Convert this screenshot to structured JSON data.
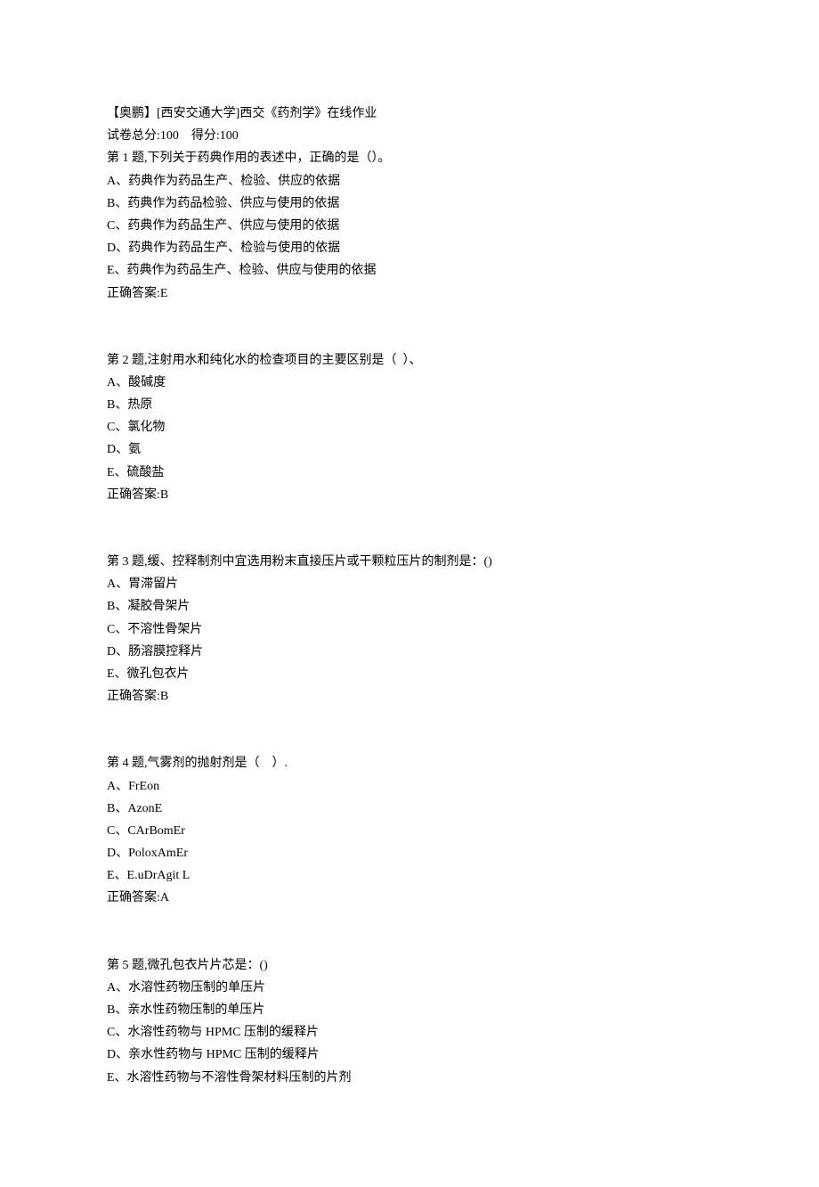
{
  "header": {
    "title": "【奥鹏】[西安交通大学]西交《药剂学》在线作业",
    "score_line": "试卷总分:100    得分:100"
  },
  "questions": [
    {
      "prompt": "第 1 题,下列关于药典作用的表述中，正确的是（）。",
      "options": [
        "A、药典作为药品生产、检验、供应的依据",
        "B、药典作为药品检验、供应与使用的依据",
        "C、药典作为药品生产、供应与使用的依据",
        "D、药典作为药品生产、检验与使用的依据",
        "E、药典作为药品生产、检验、供应与使用的依据"
      ],
      "answer": "正确答案:E"
    },
    {
      "prompt": "第 2 题,注射用水和纯化水的检查项目的主要区别是（  ）、",
      "options": [
        "A、酸碱度",
        "B、热原",
        "C、氯化物",
        "D、氨",
        "E、硫酸盐"
      ],
      "answer": "正确答案:B"
    },
    {
      "prompt": "第 3 题,缓、控释制剂中宜选用粉末直接压片或干颗粒压片的制剂是：()",
      "options": [
        "A、胃滞留片",
        "B、凝胶骨架片",
        "C、不溶性骨架片",
        "D、肠溶膜控释片",
        "E、微孔包衣片"
      ],
      "answer": "正确答案:B"
    },
    {
      "prompt": "第 4 题,气雾剂的抛射剂是（    ）.",
      "options": [
        "A、FrEon",
        "B、AzonE",
        "C、CArBomEr",
        "D、PoloxAmEr",
        "E、E.uDrAgit L"
      ],
      "answer": "正确答案:A"
    },
    {
      "prompt": "第 5 题,微孔包衣片片芯是：()",
      "options": [
        "A、水溶性药物压制的单压片",
        "B、亲水性药物压制的单压片",
        "C、水溶性药物与 HPMC 压制的缓释片",
        "D、亲水性药物与 HPMC 压制的缓释片",
        "E、水溶性药物与不溶性骨架材料压制的片剂"
      ],
      "answer": ""
    }
  ]
}
